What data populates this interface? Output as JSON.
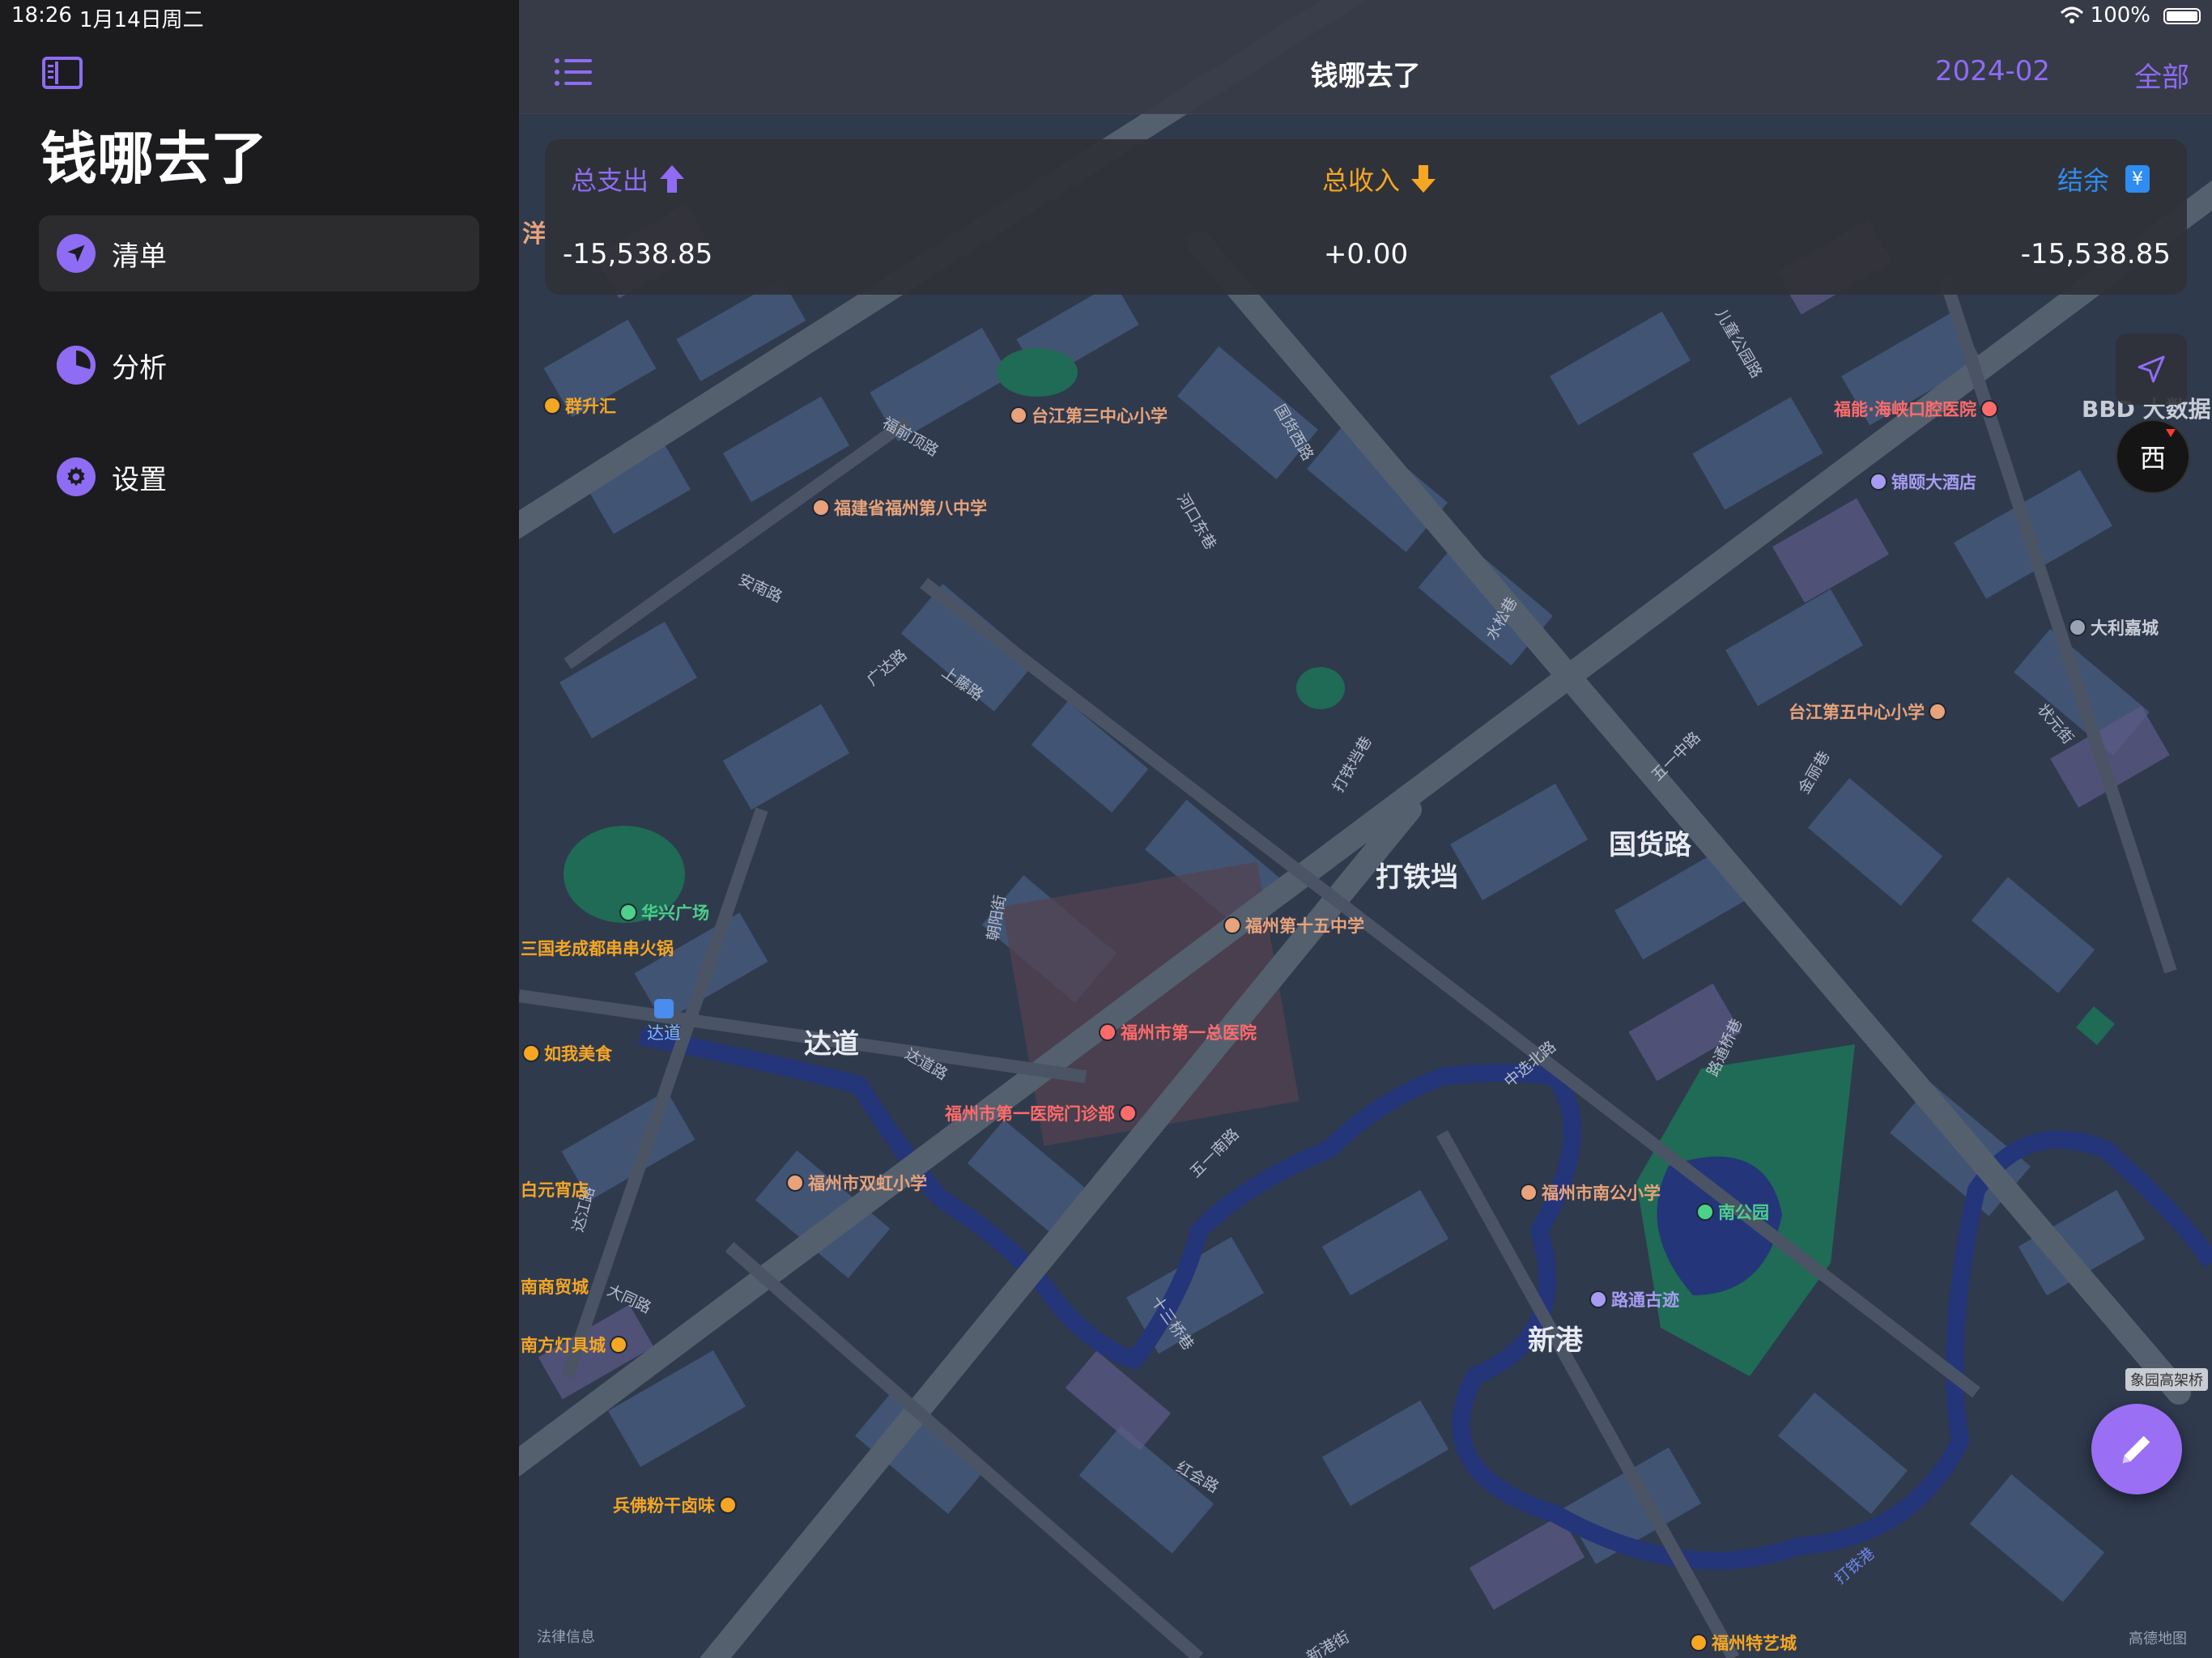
{
  "status_bar": {
    "time": "18:26",
    "date": "1月14日周二",
    "battery": "100%"
  },
  "sidebar": {
    "title": "钱哪去了",
    "items": [
      {
        "label": "清单",
        "icon": "location-arrow-icon",
        "active": true
      },
      {
        "label": "分析",
        "icon": "pie-chart-icon",
        "active": false
      },
      {
        "label": "设置",
        "icon": "gear-icon",
        "active": false
      }
    ]
  },
  "navbar": {
    "title": "钱哪去了",
    "month": "2024-02",
    "all": "全部"
  },
  "summary": {
    "expense_label": "总支出",
    "expense_value": "-15,538.85",
    "income_label": "总收入",
    "income_value": "+0.00",
    "balance_label": "结余",
    "balance_value": "-15,538.85"
  },
  "colors": {
    "accent": "#8e6cf3",
    "expense": "#8e6cf3",
    "income": "#f5a623",
    "balance": "#2f8cf0",
    "poi_school": "#e8a37a",
    "poi_hospital": "#ff6b6b",
    "poi_food": "#f5a623",
    "poi_park": "#4cd08a",
    "poi_hotel": "#a79cf2"
  },
  "compass_label": "西",
  "map": {
    "districts": [
      "打铁垱",
      "国货路",
      "达道",
      "新港"
    ],
    "pois": [
      {
        "name": "群升汇",
        "kind": "food"
      },
      {
        "name": "台江第三中心小学",
        "kind": "school"
      },
      {
        "name": "福建省福州第八中学",
        "kind": "school"
      },
      {
        "name": "福能·海峡口腔医院",
        "kind": "hospital"
      },
      {
        "name": "锦颐大酒店",
        "kind": "hotel"
      },
      {
        "name": "大利嘉城",
        "kind": "building"
      },
      {
        "name": "台江第五中心小学",
        "kind": "school"
      },
      {
        "name": "华兴广场",
        "kind": "park"
      },
      {
        "name": "三国老成都串串火锅",
        "kind": "food"
      },
      {
        "name": "达道",
        "kind": "transit"
      },
      {
        "name": "如我美食",
        "kind": "food"
      },
      {
        "name": "福州第十五中学",
        "kind": "school"
      },
      {
        "name": "福州市第一总医院",
        "kind": "hospital"
      },
      {
        "name": "福州市第一医院门诊部",
        "kind": "hospital"
      },
      {
        "name": "福州市双虹小学",
        "kind": "school"
      },
      {
        "name": "福州市南公小学",
        "kind": "school"
      },
      {
        "name": "南公园",
        "kind": "park"
      },
      {
        "name": "路通古迹",
        "kind": "hotel"
      },
      {
        "name": "白元宵店",
        "kind": "food"
      },
      {
        "name": "南商贸城",
        "kind": "food"
      },
      {
        "name": "南方灯具城",
        "kind": "food"
      },
      {
        "name": "兵佛粉干卤味",
        "kind": "food"
      },
      {
        "name": "福州特艺城",
        "kind": "food"
      },
      {
        "name": "洋",
        "kind": "food"
      },
      {
        "name": "BBD 大数据",
        "kind": "building"
      }
    ],
    "streets": [
      "国货西路",
      "五一中路",
      "五一南路",
      "广达路",
      "安南路",
      "上藤路",
      "河口东巷",
      "福前顶路",
      "水松巷",
      "打铁垱巷",
      "朝阳街",
      "达道路",
      "中选北路",
      "路通桥巷",
      "金丽巷",
      "状元街",
      "大同路",
      "达江路",
      "十三桥巷",
      "红会路",
      "新港街",
      "打铁港",
      "儿童公园路"
    ],
    "bridge": "象园高架桥",
    "legal": "法律信息",
    "attribution": "高德地图"
  }
}
